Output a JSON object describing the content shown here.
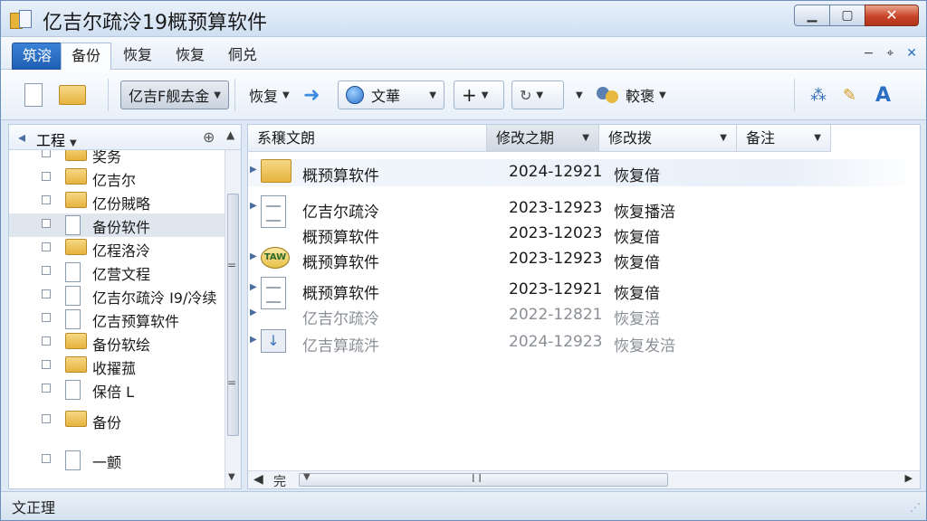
{
  "window": {
    "title": "亿吉尔疏泠19概预算软件"
  },
  "window_controls": {
    "minimize": "▁",
    "maximize": "▢",
    "close": "✕"
  },
  "tabs": [
    {
      "label": "筑溶",
      "kind": "file"
    },
    {
      "label": "备份",
      "kind": "active"
    },
    {
      "label": "恢复",
      "kind": "normal"
    },
    {
      "label": "恢复",
      "kind": "normal"
    },
    {
      "label": "侗兑",
      "kind": "normal"
    }
  ],
  "ribbon_controls": {
    "collapse": "−",
    "pin": "⌖",
    "close": "✕"
  },
  "toolbar": {
    "dropdown1": "亿吉F舰去金",
    "restore": "恢复",
    "view": "文華",
    "add": "+",
    "refresh": "↻",
    "settings": "較褒",
    "font": "A"
  },
  "nav": {
    "header": "工程",
    "items": [
      {
        "label": "奖务",
        "icon": "folder",
        "partial": true
      },
      {
        "label": "亿吉尔",
        "icon": "folder"
      },
      {
        "label": "亿份賊略",
        "icon": "folder"
      },
      {
        "label": "备份软件",
        "icon": "doc",
        "selected": true
      },
      {
        "label": "亿程洛泠",
        "icon": "folder"
      },
      {
        "label": "亿营文程",
        "icon": "doc"
      },
      {
        "label": "亿吉尔疏泠 I9/冷续",
        "icon": "doc"
      },
      {
        "label": "亿吉预算软件",
        "icon": "doc"
      },
      {
        "label": "备份软绘",
        "icon": "folder"
      },
      {
        "label": "收擢菰",
        "icon": "folder"
      },
      {
        "label": "保倍 L",
        "icon": "doc"
      },
      {
        "label": "备份",
        "icon": "folder"
      },
      {
        "label": "一颤",
        "icon": "doc"
      }
    ]
  },
  "columns": [
    {
      "label": "系穣文朗"
    },
    {
      "label": "修改之期"
    },
    {
      "label": "修改拨"
    },
    {
      "label": "备注"
    }
  ],
  "files": [
    {
      "name": "概预算软件",
      "date": "2024-12921",
      "type": "恢复偣",
      "icon": "folder",
      "highlight": true
    },
    {
      "name": "亿吉尔疏泠",
      "date": "2023-12923",
      "type": "恢复播涪",
      "icon": "doc"
    },
    {
      "name": "概预算软件",
      "date": "2023-12023",
      "type": "恢复偣",
      "icon": "none"
    },
    {
      "name": "概预算软件",
      "date": "2023-12923",
      "type": "恢复偣",
      "icon": "badge"
    },
    {
      "name": "概预算软件",
      "date": "2023-12921",
      "type": "恢复偣",
      "icon": "doc"
    },
    {
      "name": "亿吉尔疏泠",
      "date": "2022-12821",
      "type": "恢复涪",
      "icon": "none",
      "faded": true
    },
    {
      "name": "亿吉算疏汼",
      "date": "2024-12923",
      "type": "恢复发涪",
      "icon": "download",
      "faded": true
    }
  ],
  "hscroll": {
    "label": "完",
    "grip": "I I"
  },
  "badge_text": "TAW",
  "status": {
    "text": "文正理"
  }
}
